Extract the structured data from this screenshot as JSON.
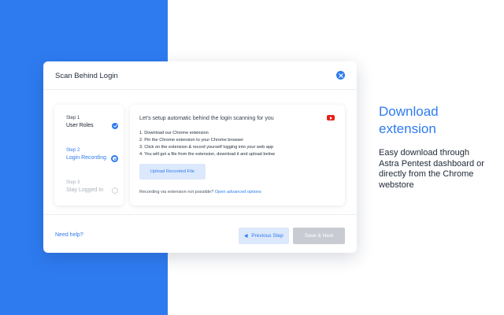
{
  "modal": {
    "title": "Scan Behind Login",
    "steps": [
      {
        "number": "Step 1",
        "label": "User Roles",
        "state": "done"
      },
      {
        "number": "Step 2",
        "label": "Login Recording",
        "state": "active"
      },
      {
        "number": "Step 3",
        "label": "Stay Logged In",
        "state": "disabled"
      }
    ],
    "content": {
      "heading": "Let's setup automatic behind the login scanning for you",
      "instructions": [
        "1. Download our Chrome extension",
        "2. Pin the Chrome extension to your Chrome browser",
        "3. Click on the extension & record yourself logging into your web app",
        "4. You will get a file from the extension, download it and upload below"
      ],
      "upload_label": "Upload Recorded File",
      "alt_text": "Recording via extension not possible?",
      "alt_link": "Open advanced options"
    },
    "footer": {
      "help_label": "Need help?",
      "prev_label": "Previous Step",
      "next_label": "Save & Next"
    }
  },
  "side": {
    "heading": "Download extension",
    "description": "Easy download through Astra Pentest dashboard or directly from the Chrome webstore"
  },
  "colors": {
    "accent": "#2e7bf0",
    "youtube": "#e62117",
    "disabled_button": "#c8ccd2"
  }
}
